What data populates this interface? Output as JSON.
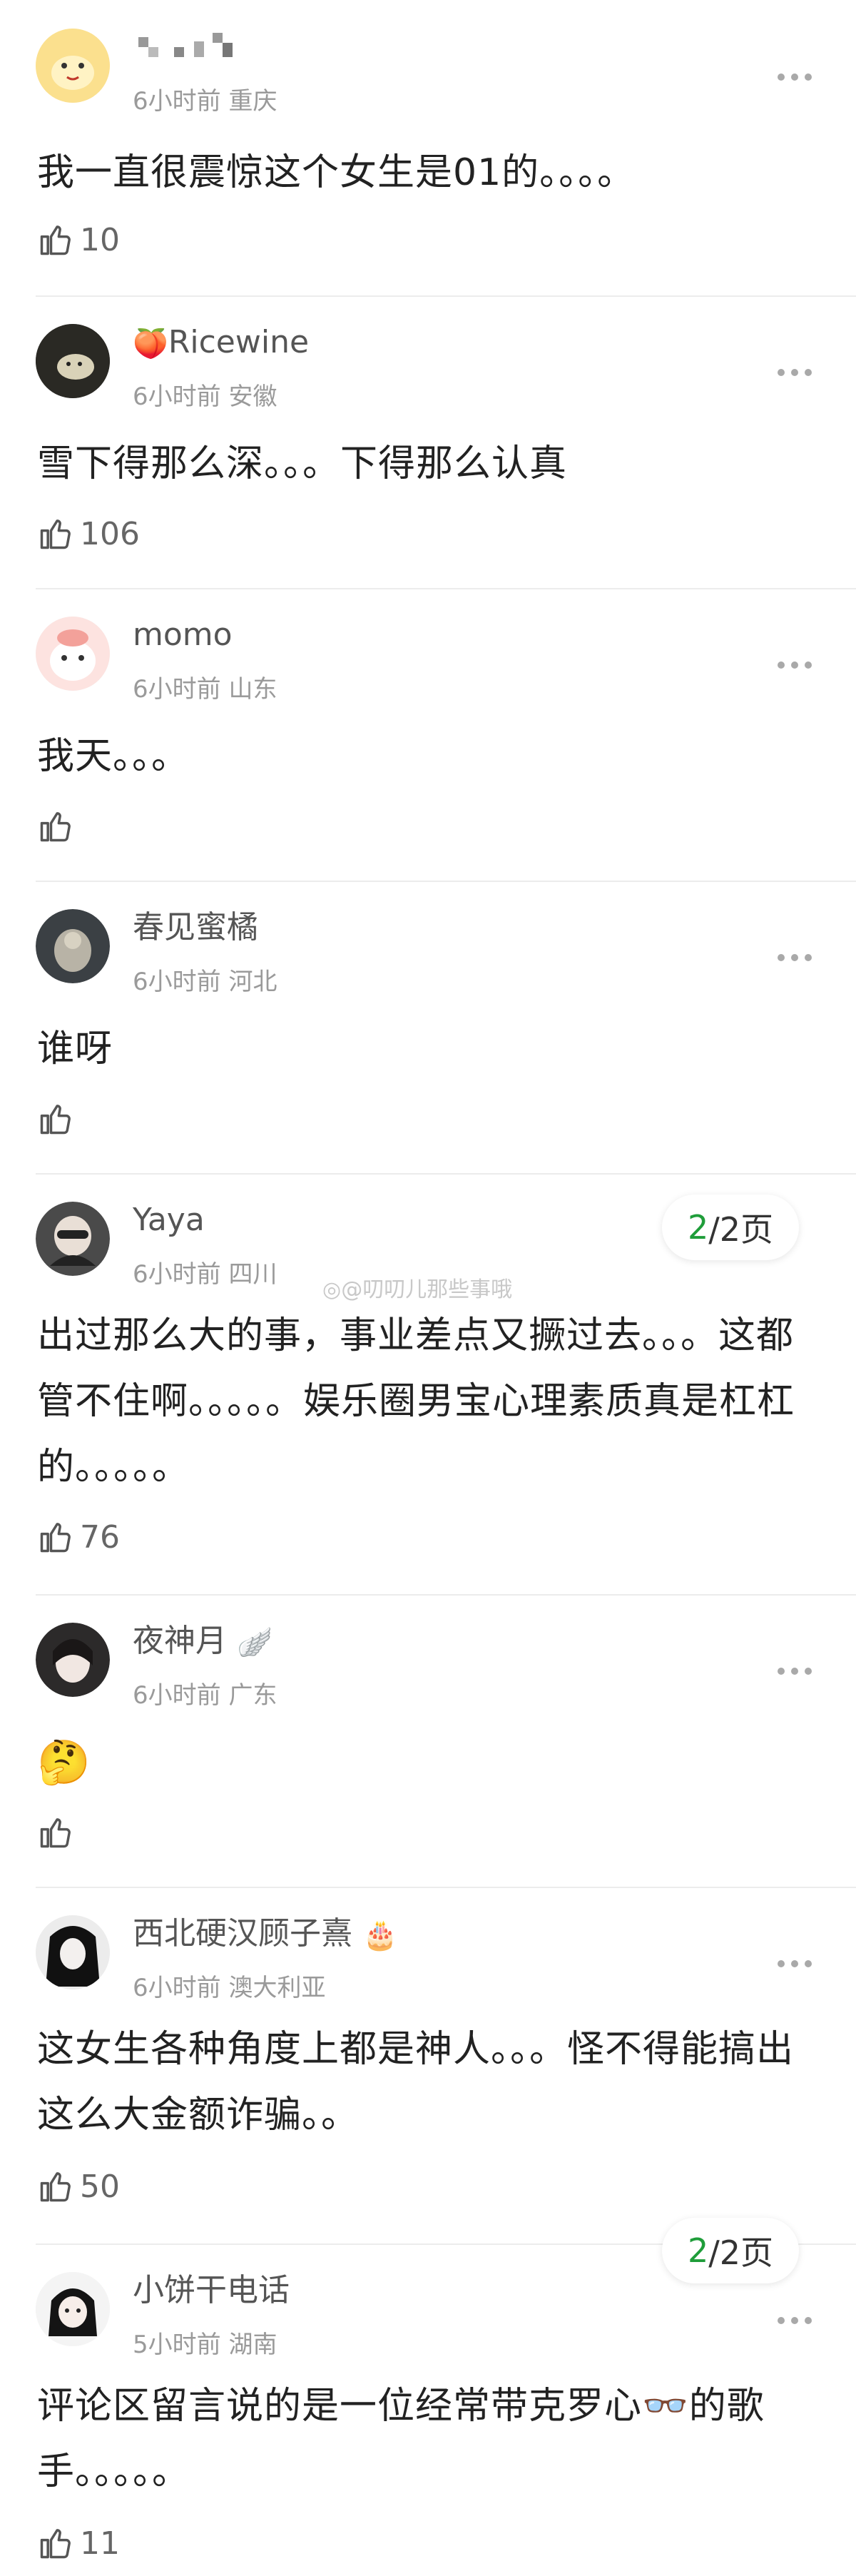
{
  "comments": [
    {
      "username": "",
      "username_censored": true,
      "time": "6小时前",
      "location": "重庆",
      "text": "我一直很震惊这个女生是01的。。。。",
      "likes": "10"
    },
    {
      "username": "Ricewine",
      "badge": "🍑",
      "time": "6小时前",
      "location": "安徽",
      "text": "雪下得那么深。。。下得那么认真",
      "likes": "106"
    },
    {
      "username": "momo",
      "time": "6小时前",
      "location": "山东",
      "text": "我天。。。",
      "likes": ""
    },
    {
      "username": "春见蜜橘",
      "time": "6小时前",
      "location": "河北",
      "text": "谁呀",
      "likes": ""
    },
    {
      "username": "Yaya",
      "time": "6小时前",
      "location": "四川",
      "text": "出过那么大的事，事业差点又撅过去。。。这都管不住啊。。。。。娱乐圈男宝心理素质真是杠杠的。。。。。",
      "likes": "76"
    },
    {
      "username": "夜神月",
      "badge": "🪽",
      "time": "6小时前",
      "location": "广东",
      "text": "🤔",
      "likes": ""
    },
    {
      "username": "西北硬汉顾子熹",
      "badge": "🎂",
      "time": "6小时前",
      "location": "澳大利亚",
      "text": "这女生各种角度上都是神人。。。怪不得能搞出这么大金额诈骗。。",
      "likes": "50"
    },
    {
      "username": "小饼干电话",
      "time": "5小时前",
      "location": "湖南",
      "text": "评论区留言说的是一位经常带克罗心👓的歌手。。。。。",
      "likes": "11"
    }
  ],
  "pager": {
    "current": "2",
    "total": "/2页"
  },
  "watermark": "@叨叨儿那些事哦",
  "icons": {
    "like": "thumbs-up-icon",
    "more": "more-dots-icon"
  }
}
